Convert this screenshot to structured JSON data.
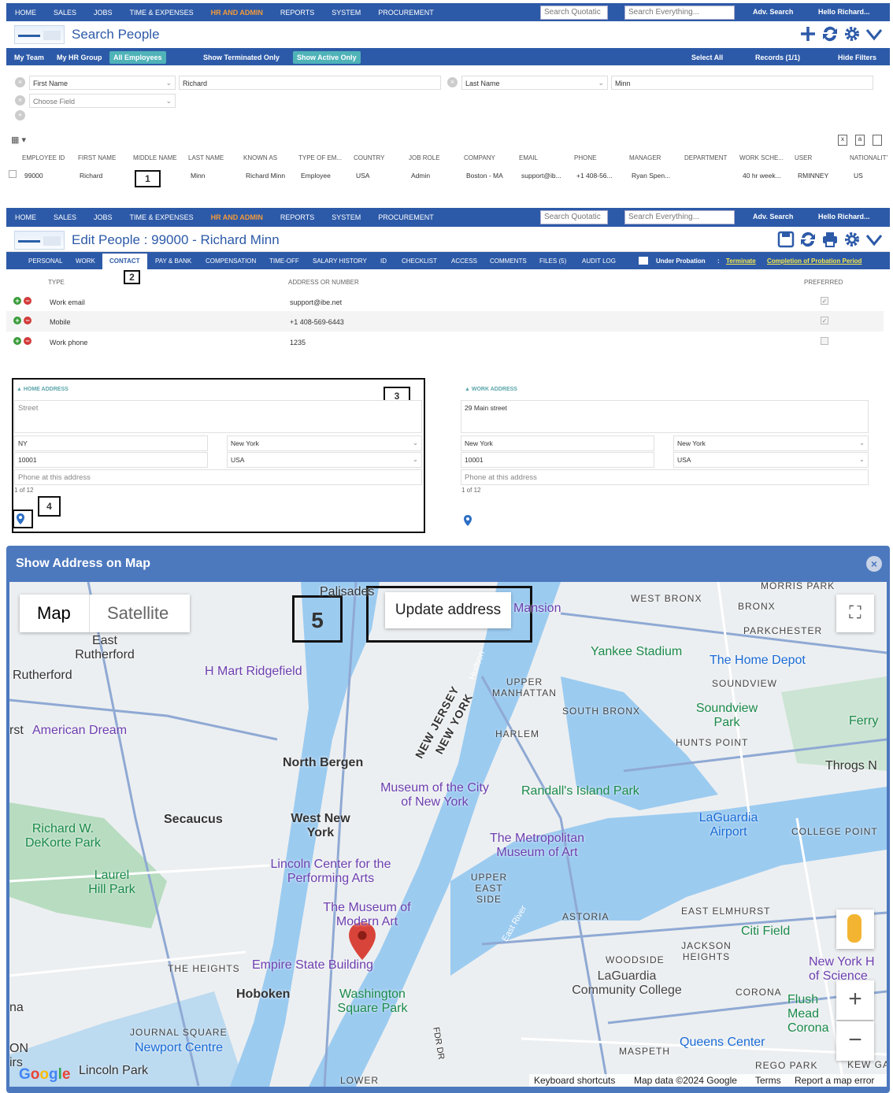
{
  "nav": {
    "items": [
      "HOME",
      "SALES",
      "JOBS",
      "TIME & EXPENSES",
      "HR AND ADMIN",
      "REPORTS",
      "SYSTEM",
      "PROCUREMENT"
    ],
    "search_quotation_placeholder": "Search Quotatic",
    "search_everything_placeholder": "Search Everything...",
    "adv_search": "Adv. Search",
    "greeting": "Hello Richard..."
  },
  "search_page": {
    "title": "Search People",
    "subbar": {
      "my_team": "My Team",
      "my_hr_group": "My HR Group",
      "all_employees": "All Employees",
      "show_terminated": "Show Terminated Only",
      "show_active": "Show Active Only",
      "select_all": "Select All",
      "records": "Records (1/1)",
      "hide_filters": "Hide Filters"
    },
    "filters": {
      "field1": "First Name",
      "value1": "Richard",
      "field2": "Last Name",
      "value2": "Minn",
      "choose_field": "Choose Field"
    },
    "columns": [
      "EMPLOYEE ID",
      "FIRST NAME",
      "MIDDLE NAME",
      "LAST NAME",
      "KNOWN AS",
      "TYPE OF EM...",
      "COUNTRY",
      "JOB ROLE",
      "COMPANY",
      "EMAIL",
      "PHONE",
      "MANAGER",
      "DEPARTMENT",
      "WORK SCHE...",
      "USER",
      "NATIONALITY"
    ],
    "row": [
      "99000",
      "Richard",
      "",
      "Minn",
      "Richard Minn",
      "Employee",
      "USA",
      "Admin",
      "Boston - MA",
      "support@ib...",
      "+1 408-56...",
      "Ryan Spen...",
      "",
      "40 hr week...",
      "RMINNEY",
      "US"
    ]
  },
  "edit_page": {
    "title": "Edit People : 99000 - Richard Minn",
    "tabs": [
      "PERSONAL",
      "WORK",
      "CONTACT",
      "PAY & BANK",
      "COMPENSATION",
      "TIME-OFF",
      "SALARY HISTORY",
      "ID",
      "CHECKLIST",
      "ACCESS",
      "COMMENTS",
      "FILES (5)",
      "AUDIT LOG"
    ],
    "probation": "Under Probation",
    "terminate": "Terminate",
    "completion": "Completion of Probation Period",
    "contact_headers": {
      "type": "TYPE",
      "address": "ADDRESS OR NUMBER",
      "preferred": "PREFERRED"
    },
    "contacts": [
      {
        "type": "Work email",
        "value": "support@ibe.net"
      },
      {
        "type": "Mobile",
        "value": "+1 408-569-6443"
      },
      {
        "type": "Work phone",
        "value": "1235"
      }
    ],
    "home_address": {
      "label": "HOME ADDRESS",
      "street_placeholder": "Street",
      "city": "NY",
      "state": "New York",
      "zip": "10001",
      "country": "USA",
      "phone_placeholder": "Phone at this address",
      "pager": "1 of 12"
    },
    "work_address": {
      "label": "WORK ADDRESS",
      "street": "29 Main street",
      "city": "New York",
      "state": "New York",
      "zip": "10001",
      "country": "USA",
      "phone_placeholder": "Phone at this address",
      "pager": "1 of 12"
    }
  },
  "callouts": [
    "1",
    "2",
    "3",
    "4",
    "5"
  ],
  "modal": {
    "title": "Show Address on Map",
    "map_btn": "Map",
    "satellite_btn": "Satellite",
    "update_address": "Update address",
    "footer": {
      "shortcuts": "Keyboard shortcuts",
      "data": "Map data ©2024 Google",
      "terms": "Terms",
      "report": "Report a map error"
    },
    "labels": {
      "palisades": "Palisades",
      "mansion": "Mansion",
      "east_rutherford": "East Rutherford",
      "rutherford": "Rutherford",
      "hmart": "H Mart Ridgefield",
      "american_dream": "American Dream",
      "north_bergen": "North Bergen",
      "secaucus": "Secaucus",
      "west_new_york": "West New York",
      "dekorte": "Richard W. DeKorte Park",
      "laurel": "Laurel Hill Park",
      "lincoln": "Lincoln Center for the Performing Arts",
      "moma": "The Museum of Modern Art",
      "esb": "Empire State Building",
      "hoboken": "Hoboken",
      "the_heights": "THE HEIGHTS",
      "washington": "Washington Square Park",
      "journal": "JOURNAL SQUARE",
      "newport": "Newport Centre",
      "lincoln_park": "Lincoln Park",
      "lower": "LOWER",
      "yankee": "Yankee Stadium",
      "home_depot": "The Home Depot",
      "upper_manhattan": "UPPER MANHATTAN",
      "south_bronx": "SOUTH BRONX",
      "soundview": "SOUNDVIEW",
      "soundview_park": "Soundview Park",
      "harlem": "HARLEM",
      "hunts_point": "HUNTS POINT",
      "nj": "NEW JERSEY",
      "ny": "NEW YORK",
      "mcny": "Museum of the City of New York",
      "randalls": "Randall's Island Park",
      "met": "The Metropolitan Museum of Art",
      "upper_east": "UPPER EAST SIDE",
      "laguardia": "LaGuardia Airport",
      "college_point": "COLLEGE POINT",
      "astoria": "ASTORIA",
      "east_elmhurst": "EAST ELMHURST",
      "citi_field": "Citi Field",
      "jackson": "JACKSON HEIGHTS",
      "woodside": "WOODSIDE",
      "laguardia_cc": "LaGuardia Community College",
      "corona": "CORONA",
      "maspeth": "MASPETH",
      "queens": "Queens Center",
      "rego": "REGO PARK",
      "west_bronx": "WEST BRONX",
      "bronx": "BRONX",
      "parkchester": "PARKCHESTER",
      "morris": "MORRIS PARK",
      "throgs": "Throgs N",
      "ferry": "Ferry",
      "nyhs": "New York H of Science",
      "flushing": "Flush Mead Corona",
      "kew": "KEW GA",
      "east_river": "East River",
      "hudson": "Hudson",
      "fdr": "FDR DR",
      "rst": "rst",
      "na": "na",
      "on": "ON",
      "irs": "irs"
    }
  }
}
